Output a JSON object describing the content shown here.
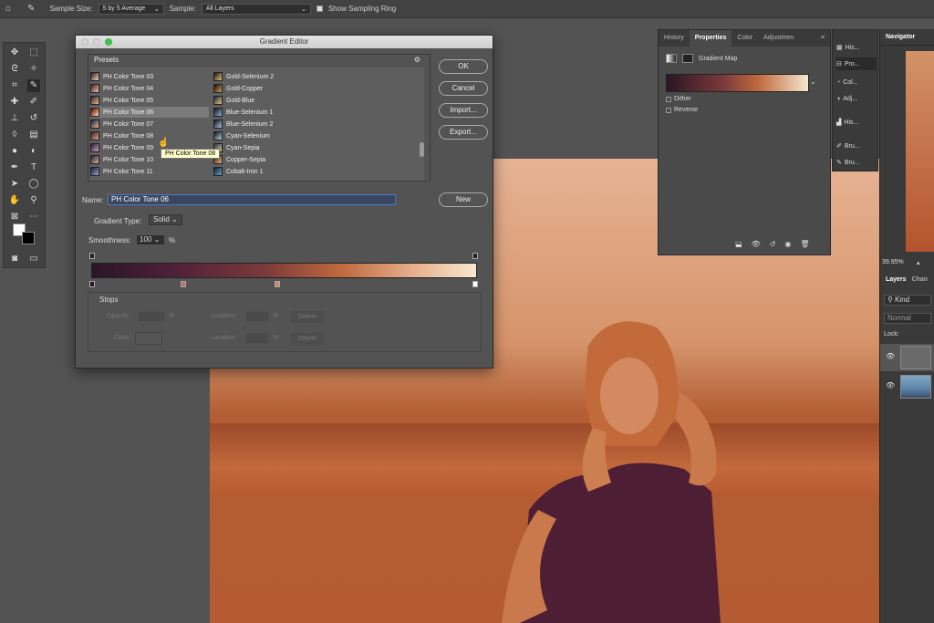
{
  "options_bar": {
    "sample_size_label": "Sample Size:",
    "sample_size_value": "5 by 5 Average",
    "sample_label": "Sample:",
    "sample_value": "All Layers",
    "sampling_ring_label": "Show Sampling Ring"
  },
  "dialog": {
    "title": "Gradient Editor",
    "presets_label": "Presets",
    "buttons": {
      "ok": "OK",
      "cancel": "Cancel",
      "import": "Import...",
      "export": "Export...",
      "new": "New"
    },
    "presets_left": [
      "PH Color Tone 03",
      "PH Color Tone 04",
      "PH Color Tone 05",
      "PH Color Tone 06",
      "PH Color Tone 07",
      "PH Color Tone 08",
      "PH Color Tone 09",
      "PH Color Tone 10",
      "PH Color Tone 11"
    ],
    "presets_right": [
      "Gold-Selenium 2",
      "Gold-Copper",
      "Gold-Blue",
      "Blue-Selenium 1",
      "Blue-Selenium 2",
      "Cyan-Selenium",
      "Cyan-Sepia",
      "Copper-Sepia",
      "Cobalt-Iron 1"
    ],
    "tooltip": "PH Color Tone 08",
    "name_label": "Name:",
    "name_value": "PH Color Tone 06",
    "gradient_type_label": "Gradient Type:",
    "gradient_type_value": "Solid",
    "smoothness_label": "Smoothness:",
    "smoothness_value": "100",
    "smoothness_unit": "%",
    "stops_label": "Stops",
    "opacity_label": "Opacity:",
    "percent1": "%",
    "location_label": "Location:",
    "percent2": "%",
    "delete_label": "Delete",
    "color_label": "Color:",
    "location_label2": "Location:",
    "percent3": "%",
    "delete_label2": "Delete"
  },
  "properties": {
    "tabs": [
      "History",
      "Properties",
      "Color",
      "Adjustmen"
    ],
    "adj_name": "Gradient Map",
    "dither": "Dither",
    "reverse": "Reverse"
  },
  "dock": [
    "His...",
    "Pro...",
    "Col...",
    "Adj...",
    "His...",
    "Bru...",
    "Bru..."
  ],
  "navigator": {
    "title": "Navigator",
    "zoom": "39.95%"
  },
  "layers": {
    "tab1": "Layers",
    "tab2": "Chan",
    "kind_placeholder": "Kind",
    "blend": "Normal",
    "lock": "Lock:"
  }
}
